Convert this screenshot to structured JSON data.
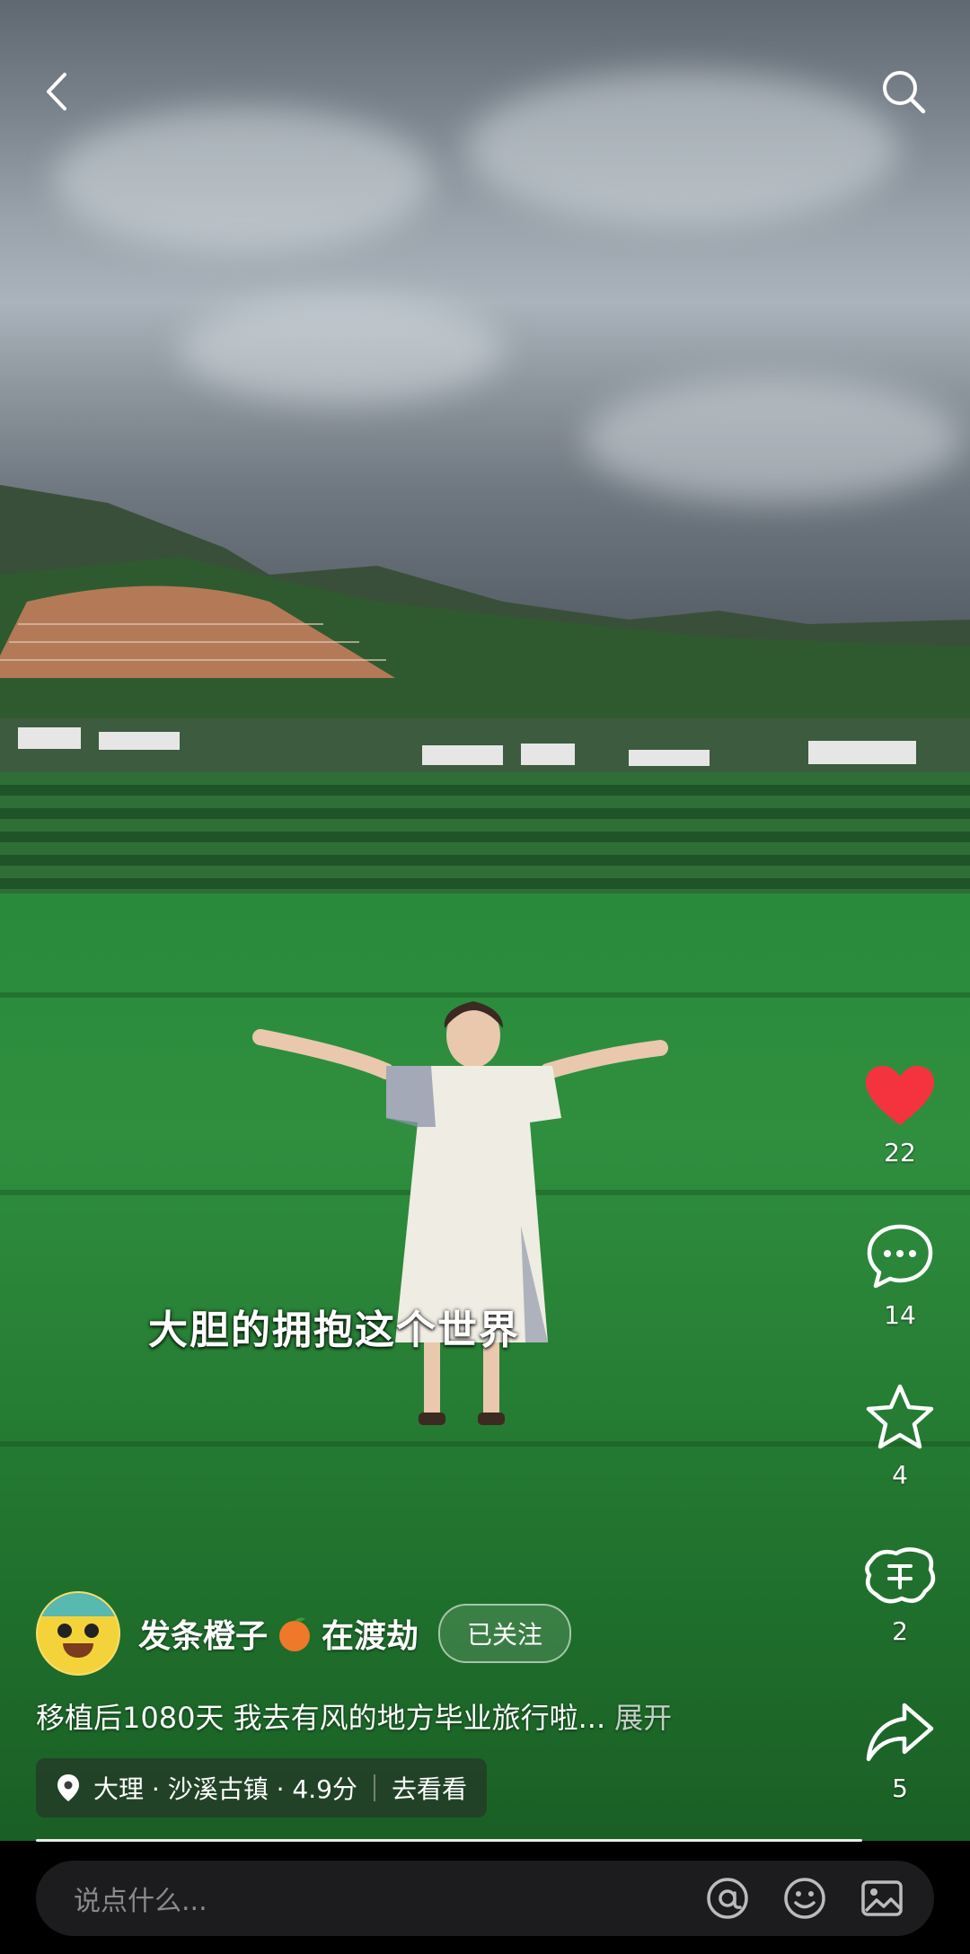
{
  "video": {
    "subtitle": "大胆的拥抱这个世界"
  },
  "actions": {
    "likes": "22",
    "comments": "14",
    "favorites": "4",
    "shares_small": "2",
    "shares": "5",
    "like_color": "#f5333f"
  },
  "author": {
    "name": "发条橙子",
    "name_suffix": "在渡劫",
    "follow_label": "已关注"
  },
  "post": {
    "caption": "移植后1080天 我去有风的地方毕业旅行啦...",
    "expand_label": "展开"
  },
  "location": {
    "text": "大理 · 沙溪古镇 · 4.9分",
    "action_label": "去看看"
  },
  "comment": {
    "placeholder": "说点什么..."
  }
}
